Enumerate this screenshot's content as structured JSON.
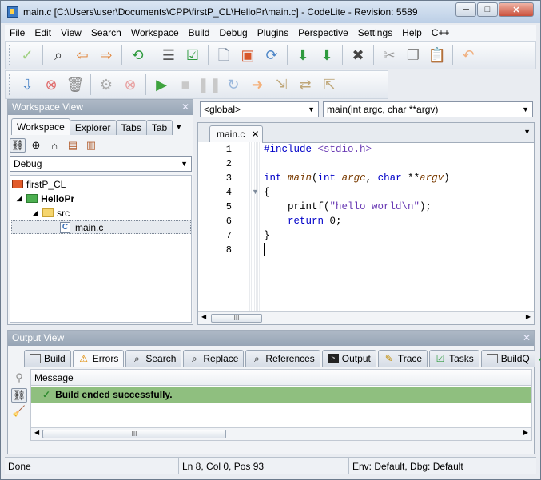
{
  "window": {
    "title": "main.c [C:\\Users\\user\\Documents\\CPP\\firstP_CL\\HelloPr\\main.c] - CodeLite - Revision: 5589",
    "controls": [
      "─",
      "□",
      "✕"
    ]
  },
  "menu": [
    "File",
    "Edit",
    "View",
    "Search",
    "Workspace",
    "Build",
    "Debug",
    "Plugins",
    "Perspective",
    "Settings",
    "Help",
    "C++"
  ],
  "workspace_view": {
    "title": "Workspace View",
    "tabs": [
      "Workspace",
      "Explorer",
      "Tabs",
      "Tab"
    ],
    "configuration": "Debug",
    "tree": [
      {
        "label": "firstP_CL",
        "bold": false
      },
      {
        "label": "HelloPr",
        "bold": true
      },
      {
        "label": "src",
        "bold": false
      },
      {
        "label": "main.c",
        "bold": false
      }
    ]
  },
  "editor": {
    "scope_combo": "<global>",
    "function_combo": "main(int argc, char **argv)",
    "tab_label": "main.c",
    "line_numbers": [
      "1",
      "2",
      "3",
      "4",
      "5",
      "6",
      "7",
      "8"
    ],
    "code": {
      "l1_directive": "#include",
      "l1_header": " <stdio.h>",
      "l3_int": "int",
      "l3_main": " main",
      "l3_open": "(",
      "l3_int2": "int",
      "l3_argc": " argc",
      "l3_comma": ", ",
      "l3_char": "char",
      "l3_stars": " **",
      "l3_argv": "argv",
      "l3_close": ")",
      "l4": "{",
      "l5_fn": "    printf(",
      "l5_str": "\"hello world\\n\"",
      "l5_end": ");",
      "l6_ret": "    return",
      "l6_val": " 0;",
      "l7": "}"
    }
  },
  "output_view": {
    "title": "Output View",
    "tabs": [
      "Build",
      "Errors",
      "Search",
      "Replace",
      "References",
      "Output",
      "Trace",
      "Tasks",
      "BuildQ"
    ],
    "column_header": "Message",
    "message": "Build ended successfully."
  },
  "status": {
    "state": "Done",
    "position": "Ln 8,  Col 0,  Pos 93",
    "env": "Env: Default, Dbg: Default"
  },
  "colors": {
    "success_row": "#8fbf7f",
    "panel_header": "#9eabbb"
  }
}
